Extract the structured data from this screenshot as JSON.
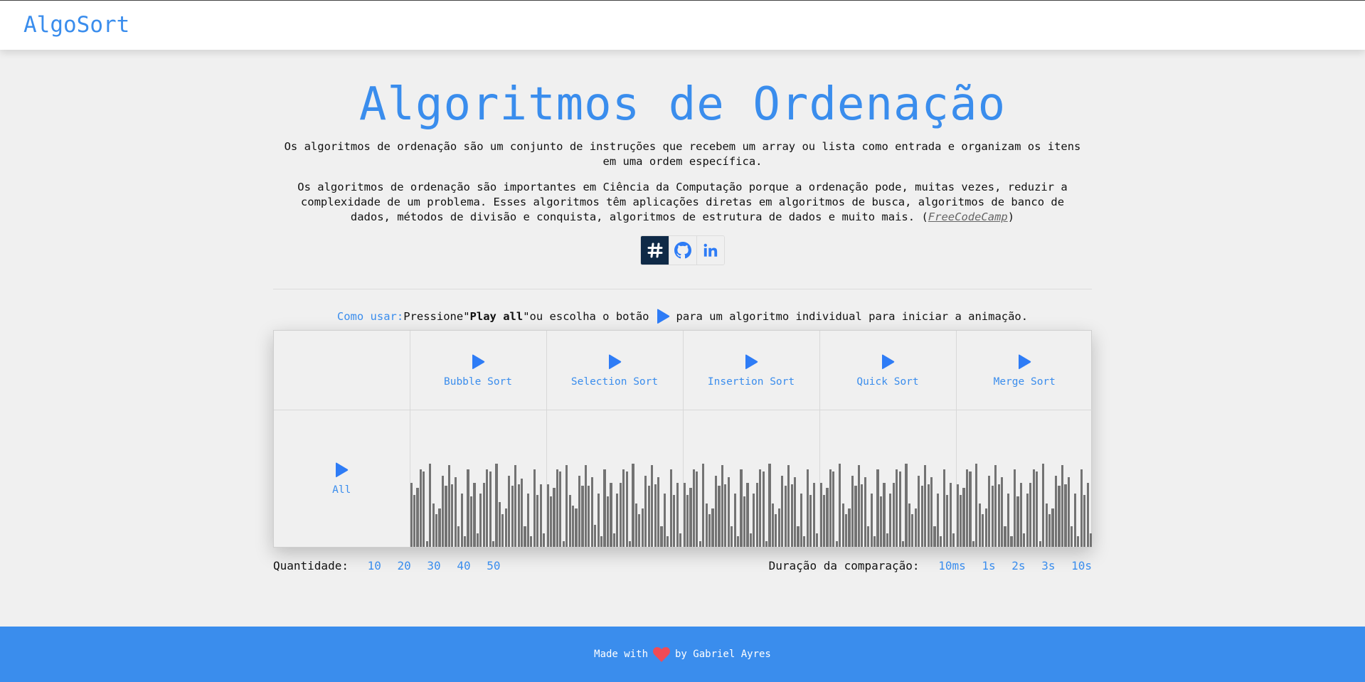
{
  "nav": {
    "brand": "AlgoSort"
  },
  "hero": {
    "title": "Algoritmos de Ordenação",
    "paragraph1": "Os algoritmos de ordenação são um conjunto de instruções que recebem um array ou lista como entrada e organizam os itens em uma ordem específica.",
    "paragraph2": "Os algoritmos de ordenação são importantes em Ciência da Computação porque a ordenação pode, muitas vezes, reduzir a complexidade de um problema. Esses algoritmos têm aplicações diretas em algoritmos de busca, algoritmos de banco de dados, métodos de divisão e conquista, algoritmos de estrutura de dados e muito mais.",
    "source_open": "(",
    "source": "FreeCodeCamp",
    "source_close": ")"
  },
  "social": [
    {
      "icon": "hash-icon",
      "active": true
    },
    {
      "icon": "github-icon",
      "active": false
    },
    {
      "icon": "linkedin-icon",
      "active": false
    }
  ],
  "howto": {
    "label": "Como usar:",
    "text1": "Pressione\"",
    "bold": "Play all",
    "text2": "\"ou escolha o botão",
    "text3": "para um algoritmo individual para iniciar a animação."
  },
  "algorithms": [
    {
      "name": "Bubble Sort",
      "values": [
        47,
        38,
        43,
        57,
        55,
        4,
        61,
        32,
        24,
        28,
        52,
        45,
        60,
        46,
        51,
        15,
        39,
        8,
        57,
        37,
        47,
        10,
        39,
        47,
        57,
        55,
        4,
        61,
        33,
        24,
        28,
        52,
        45,
        60,
        46,
        50,
        15,
        39,
        8,
        57,
        38,
        46,
        10
      ]
    },
    {
      "name": "Selection Sort",
      "values": [
        46,
        37,
        43,
        57,
        55,
        4,
        60,
        38,
        30,
        28,
        52,
        45,
        60,
        45,
        51,
        16,
        39,
        8,
        57,
        37,
        47,
        10,
        39,
        47,
        57,
        55,
        4,
        61,
        32,
        24,
        28,
        52,
        45,
        60,
        46,
        51,
        15,
        39,
        8,
        57,
        38,
        47,
        10
      ]
    },
    {
      "name": "Insertion Sort",
      "values": [
        47,
        38,
        43,
        57,
        55,
        4,
        61,
        32,
        24,
        28,
        52,
        45,
        60,
        46,
        51,
        15,
        39,
        8,
        57,
        37,
        47,
        10,
        39,
        47,
        57,
        55,
        4,
        61,
        32,
        24,
        28,
        52,
        45,
        60,
        46,
        51,
        15,
        39,
        8,
        57,
        38,
        47,
        10
      ]
    },
    {
      "name": "Quick Sort",
      "values": [
        47,
        38,
        43,
        57,
        55,
        4,
        61,
        32,
        24,
        28,
        52,
        45,
        60,
        46,
        51,
        15,
        39,
        8,
        57,
        37,
        47,
        10,
        39,
        47,
        57,
        55,
        4,
        61,
        32,
        24,
        28,
        52,
        45,
        60,
        46,
        51,
        15,
        39,
        8,
        57,
        38,
        47,
        10
      ]
    },
    {
      "name": "Merge Sort",
      "values": [
        46,
        38,
        43,
        57,
        55,
        4,
        61,
        32,
        24,
        28,
        52,
        45,
        60,
        46,
        51,
        15,
        39,
        8,
        57,
        37,
        47,
        10,
        39,
        47,
        57,
        55,
        4,
        61,
        32,
        24,
        28,
        52,
        45,
        60,
        46,
        51,
        15,
        39,
        8,
        57,
        38,
        47,
        10
      ]
    }
  ],
  "all_label": "All",
  "controls": {
    "quantity_label": "Quantidade:",
    "quantity_options": [
      "10",
      "20",
      "30",
      "40",
      "50"
    ],
    "duration_label": "Duração da comparação:",
    "duration_options": [
      "10ms",
      "1s",
      "2s",
      "3s",
      "10s"
    ]
  },
  "footer": {
    "text1": "Made with",
    "text2": "by Gabriel Ayres"
  },
  "colors": {
    "accent": "#3a8ded",
    "play": "#2e7cf6",
    "bar": "#737373",
    "dark_button": "#0f2a47",
    "heart": "#f04b55"
  }
}
